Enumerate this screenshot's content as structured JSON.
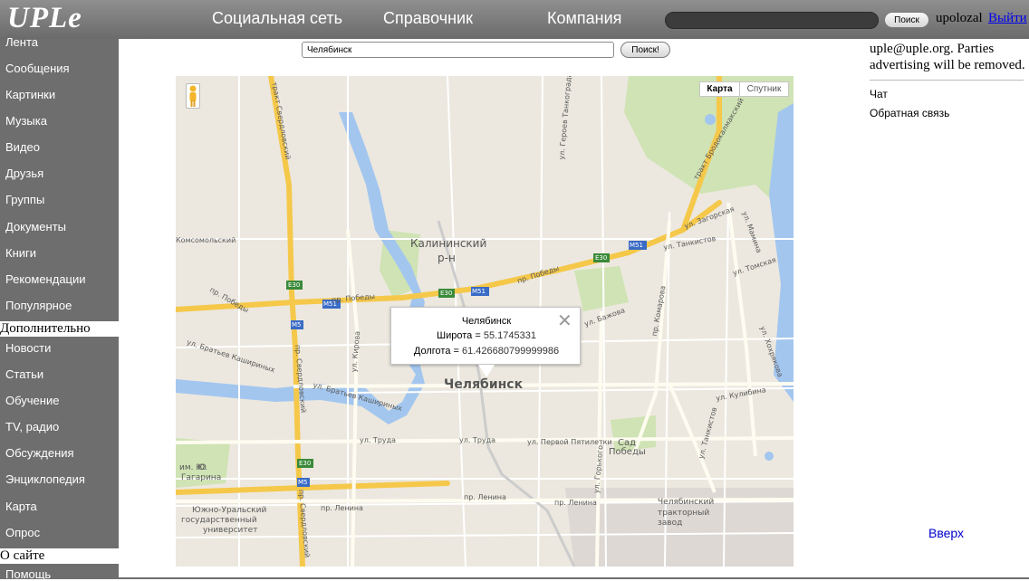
{
  "header": {
    "logo": "UPLe",
    "nav": [
      "Социальная сеть",
      "Справочник",
      "Компания"
    ],
    "search_button": "Поиск",
    "username": "upolozal",
    "logout": "Выйти"
  },
  "sidebar": {
    "items_top": [
      "Лента",
      "Сообщения",
      "Картинки",
      "Музыка",
      "Видео",
      "Друзья",
      "Группы",
      "Документы",
      "Книги",
      "Рекомендации",
      "Популярное"
    ],
    "section_more": "Дополнительно",
    "items_more": [
      "Новости",
      "Статьи",
      "Обучение",
      "TV, радио",
      "Обсуждения",
      "Энциклопедия",
      "Карта",
      "Опрос"
    ],
    "section_about": "О сайте",
    "items_about": [
      "Помощь"
    ]
  },
  "search": {
    "value": "Челябинск",
    "button": "Поиск!"
  },
  "map": {
    "type_map": "Карта",
    "type_satellite": "Спутник",
    "popup": {
      "title": "Челябинск",
      "lat_label": "Широта",
      "lat_value": "55.1745331",
      "lon_label": "Долгота",
      "lon_value": "61.426680799999986"
    },
    "labels": {
      "district": "Калининский",
      "district2": "р-н",
      "city": "Челябинск",
      "street_pobedy": "пр. Победы",
      "street_pobedy2": "пр. Победы",
      "street_truda": "ул. Труда",
      "street_truda2": "ул. Труда",
      "street_pyatiletki": "ул. Первой Пятилетки",
      "street_lenina": "пр. Ленина",
      "street_lenina2": "пр. Ленина",
      "street_lenina3": "пр. Ленина",
      "street_kirova": "ул. Кирова",
      "street_kashirinyh": "ул. Братьев Кашириных",
      "street_kashirinyh2": "ул. Братьев Кашириных",
      "street_bazhova": "ул. Бажова",
      "street_kulibina": "ул. Кулибина",
      "street_komarova": "пр. Комарова",
      "street_gorkogo": "ул. Горького",
      "street_tankistov": "ул. Танкистов",
      "street_tankistov2": "ул. Танкистов",
      "street_tomskaya": "ул. Томская",
      "street_zagorskaya": "ул. Загорская",
      "street_mamina": "ул. Мамина",
      "street_hohryakova": "ул. Хохрякова",
      "street_komsomolsky": "Комсомольский",
      "street_geroev": "ул. Героев Танкограда",
      "trakt_sverdl": "тракт Свердловский",
      "trakt_sverdl2": "пр. Свердловский",
      "trakt_sverdl3": "пр. Свердловский",
      "trakt_brod": "тракт Бродокалмакский",
      "sad_pobedy": "Сад",
      "sad_pobedy2": "Победы",
      "university": "Южно-Уральский",
      "university2": "государственный",
      "university3": "университет",
      "factory": "Челябинский",
      "factory2": "тракторный",
      "factory3": "завод",
      "park_oim": "Ю",
      "park_oim2": "им. Ю.",
      "park_oim3": "Гагарина",
      "hw_e30": "E30",
      "hw_m51": "M51",
      "hw_m5": "M5"
    }
  },
  "right": {
    "contact": "uple@uple.org. Parties",
    "contact2": "advertising will be removed.",
    "chat": "Чат",
    "feedback": "Обратная связь",
    "top": "Вверх"
  }
}
